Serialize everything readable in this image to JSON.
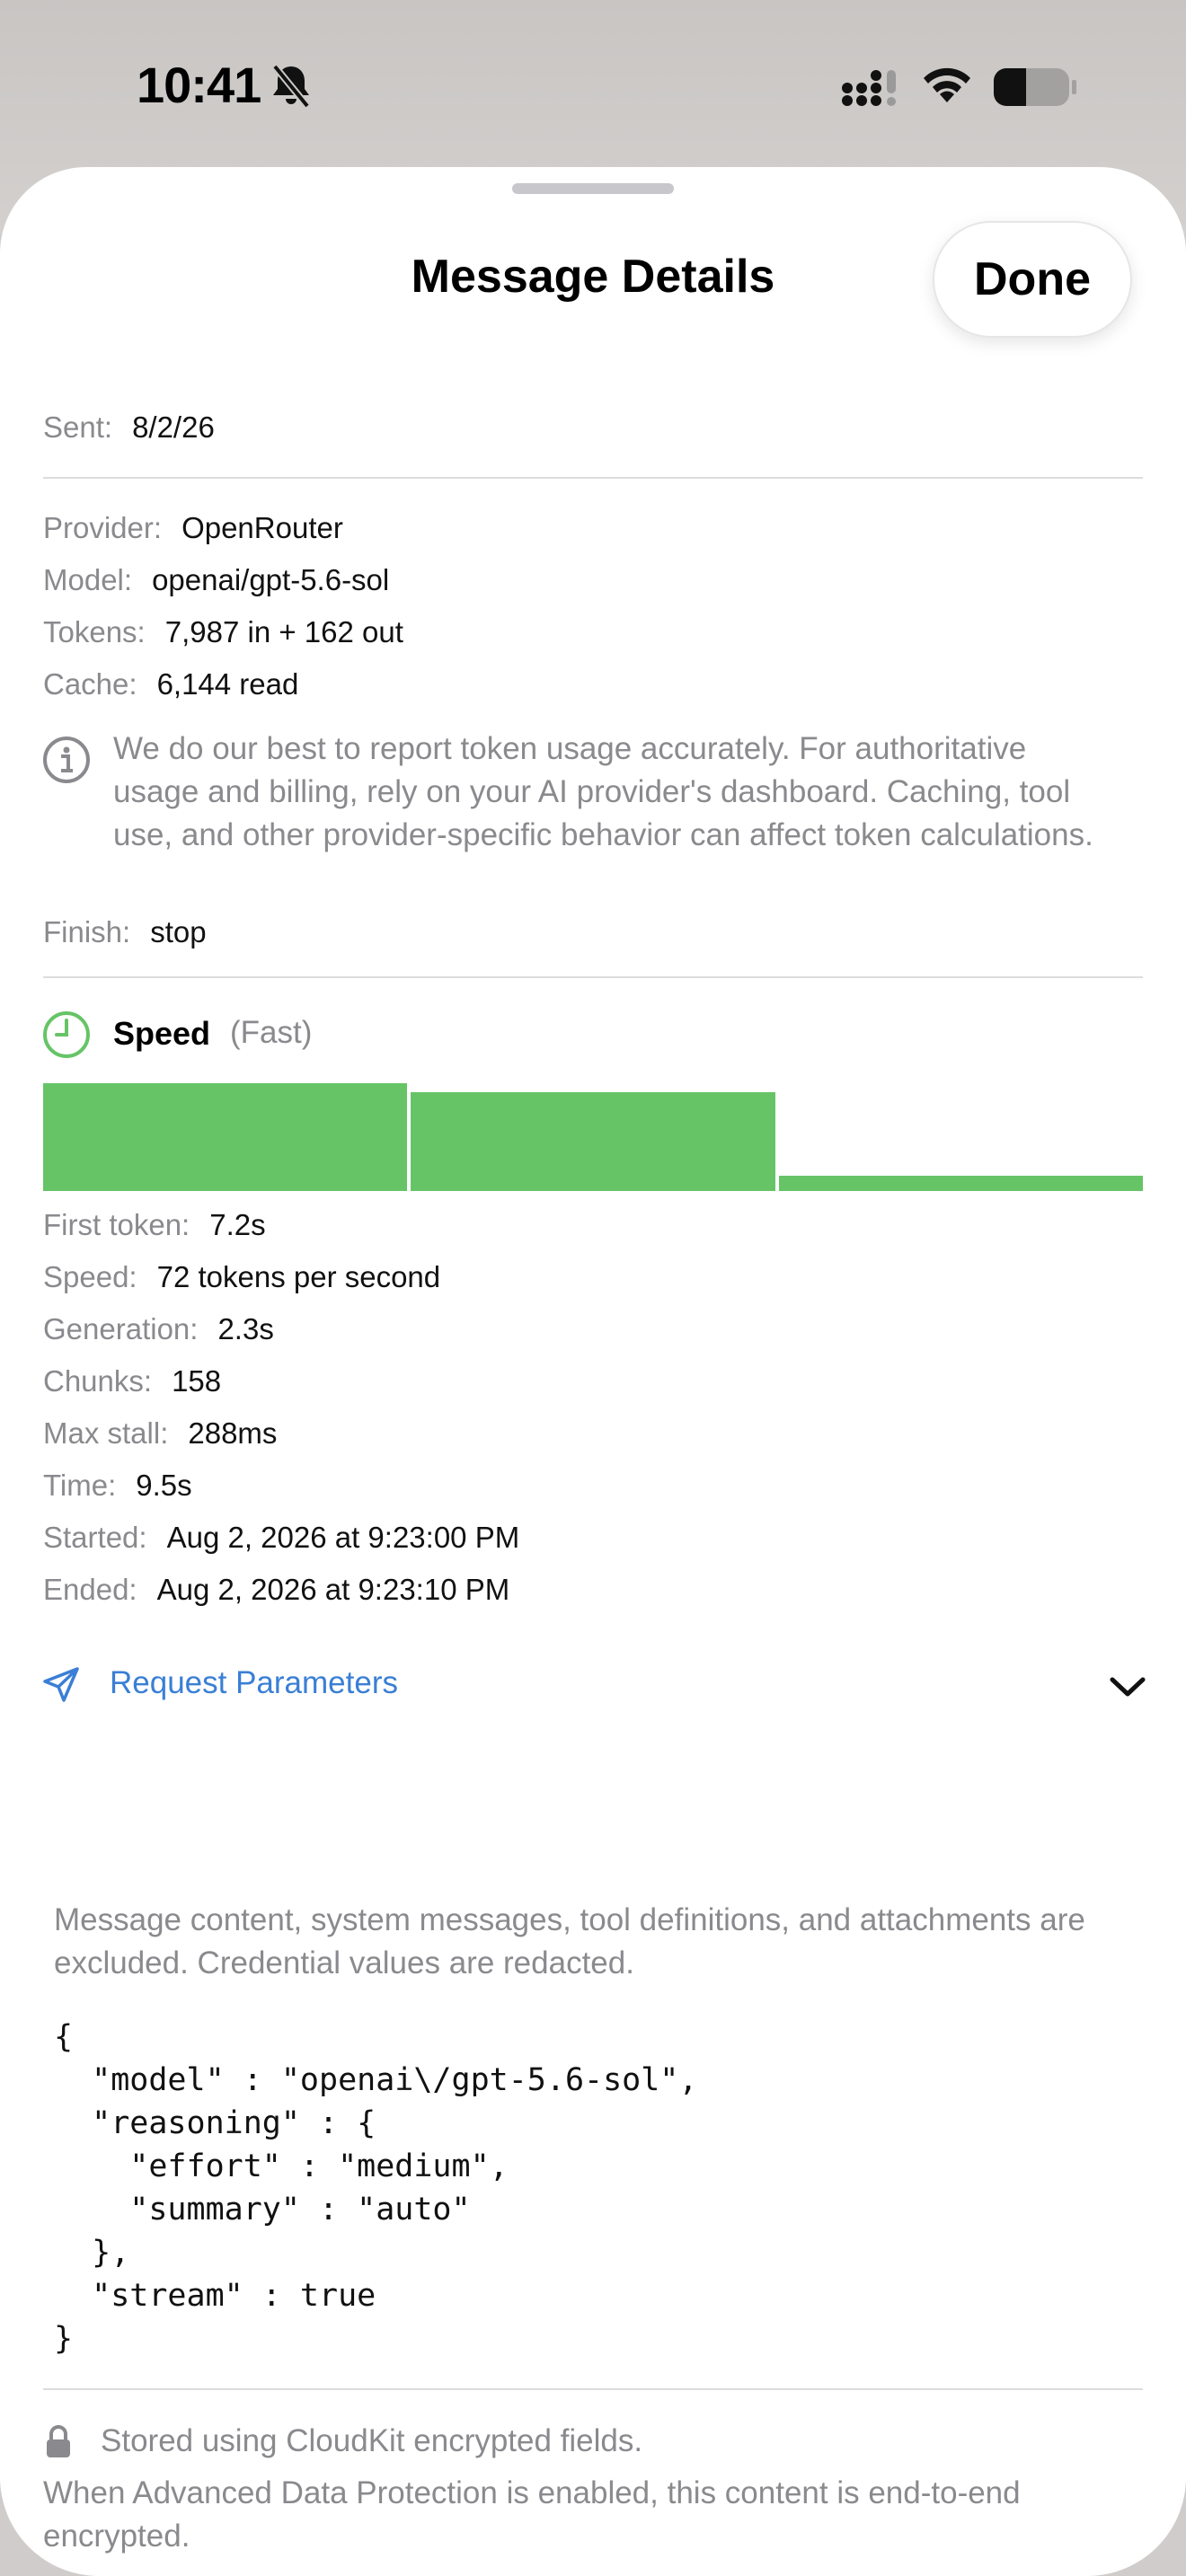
{
  "status_bar": {
    "time": "10:41"
  },
  "sheet": {
    "title": "Message Details",
    "done_label": "Done"
  },
  "sent": {
    "label": "Sent:",
    "value": "8/2/26"
  },
  "usage": {
    "provider": {
      "label": "Provider:",
      "value": "OpenRouter"
    },
    "model": {
      "label": "Model:",
      "value": "openai/gpt-5.6-sol"
    },
    "tokens": {
      "label": "Tokens:",
      "value": "7,987 in + 162 out"
    },
    "cache": {
      "label": "Cache:",
      "value": "6,144 read"
    },
    "disclaimer": "We do our best to report token usage accurately. For authoritative usage and billing, rely on your AI provider's dashboard. Caching, tool use, and other provider-specific behavior can affect token calculations.",
    "finish": {
      "label": "Finish:",
      "value": "stop"
    }
  },
  "speed": {
    "title": "Speed",
    "rating": "(Fast)",
    "accent_color": "#66c466",
    "bar_levels": [
      1.0,
      0.92,
      0.14
    ],
    "stats": [
      {
        "label": "First token:",
        "value": "7.2s"
      },
      {
        "label": "Speed:",
        "value": "72 tokens per second"
      },
      {
        "label": "Generation:",
        "value": "2.3s"
      },
      {
        "label": "Chunks:",
        "value": "158"
      },
      {
        "label": "Max stall:",
        "value": "288ms"
      },
      {
        "label": "Time:",
        "value": "9.5s"
      },
      {
        "label": "Started:",
        "value": "Aug 2, 2026 at 9:23:00 PM"
      },
      {
        "label": "Ended:",
        "value": "Aug 2, 2026 at 9:23:10 PM"
      }
    ]
  },
  "request_parameters": {
    "title": "Request Parameters",
    "link_color": "#3a7fd5",
    "note": "Message content, system messages, tool definitions, and attachments are excluded. Credential values are redacted.",
    "json_text": "{\n  \"model\" : \"openai\\/gpt-5.6-sol\",\n  \"reasoning\" : {\n    \"effort\" : \"medium\",\n    \"summary\" : \"auto\"\n  },\n  \"stream\" : true\n}"
  },
  "storage": {
    "stored": "Stored using CloudKit encrypted fields.",
    "adp": "When Advanced Data Protection is enabled, this content is end-to-end encrypted."
  },
  "icons": {
    "status": [
      "bell-slash-icon",
      "cellular-signal-icon",
      "wifi-icon",
      "battery-icon"
    ],
    "info": "info-circle-icon",
    "speed": "clock-icon",
    "request": "paper-plane-icon",
    "chevron": "chevron-down-icon",
    "lock": "lock-icon"
  }
}
